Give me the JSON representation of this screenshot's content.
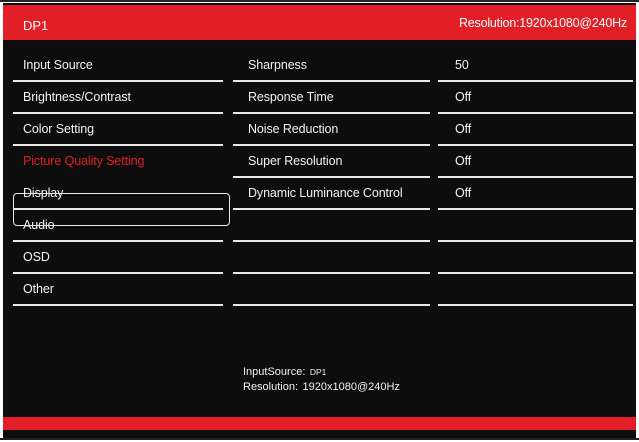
{
  "header": {
    "title": "DP1",
    "resolution": "Resolution:1920x1080@240Hz"
  },
  "menu": {
    "items": [
      {
        "label": "Input Source"
      },
      {
        "label": "Brightness/Contrast"
      },
      {
        "label": "Color Setting"
      },
      {
        "label": "Picture Quality Setting",
        "selected": true
      },
      {
        "label": "Display"
      },
      {
        "label": "Audio"
      },
      {
        "label": "OSD"
      },
      {
        "label": "Other"
      }
    ]
  },
  "submenu": {
    "items": [
      {
        "label": "Sharpness",
        "value": "50"
      },
      {
        "label": "Response Time",
        "value": "Off"
      },
      {
        "label": "Noise Reduction",
        "value": "Off"
      },
      {
        "label": "Super Resolution",
        "value": "Off"
      },
      {
        "label": "Dynamic Luminance Control",
        "value": "Off"
      },
      {
        "label": "",
        "value": ""
      },
      {
        "label": "",
        "value": ""
      },
      {
        "label": "",
        "value": ""
      }
    ]
  },
  "info": {
    "input_label": "InputSource:",
    "input_value": "DP1",
    "res_label": "Resolution:",
    "res_value": "1920x1080@240Hz"
  },
  "colors": {
    "accent": "#e21f26",
    "background": "#0d0d0d",
    "text": "#f2f2f2"
  }
}
